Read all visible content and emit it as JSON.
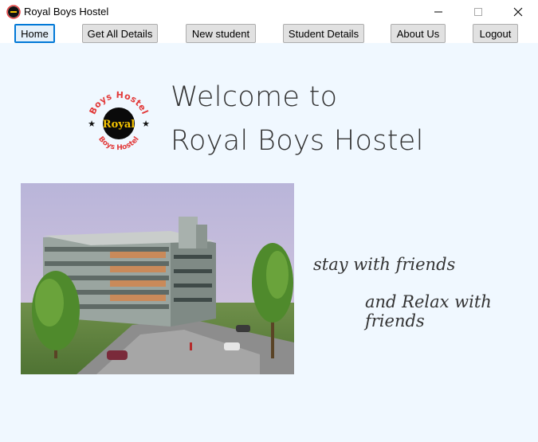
{
  "window": {
    "title": "Royal Boys Hostel"
  },
  "nav": {
    "home": "Home",
    "get_all_details": "Get All Details",
    "new_student": "New student",
    "student_details": "Student Details",
    "about_us": "About Us",
    "logout": "Logout"
  },
  "hero": {
    "welcome_line1": "Welcome to",
    "welcome_line2": "Royal Boys Hostel"
  },
  "logo": {
    "ring_text": "Boys Hostel",
    "center_text": "Royal"
  },
  "taglines": {
    "line1": "stay with friends",
    "line2": "and Relax with friends"
  },
  "colors": {
    "content_background": "#f0f8ff",
    "active_button_border": "#0078d7",
    "logo_red": "#e23a3a",
    "logo_gold": "#f5c400"
  }
}
